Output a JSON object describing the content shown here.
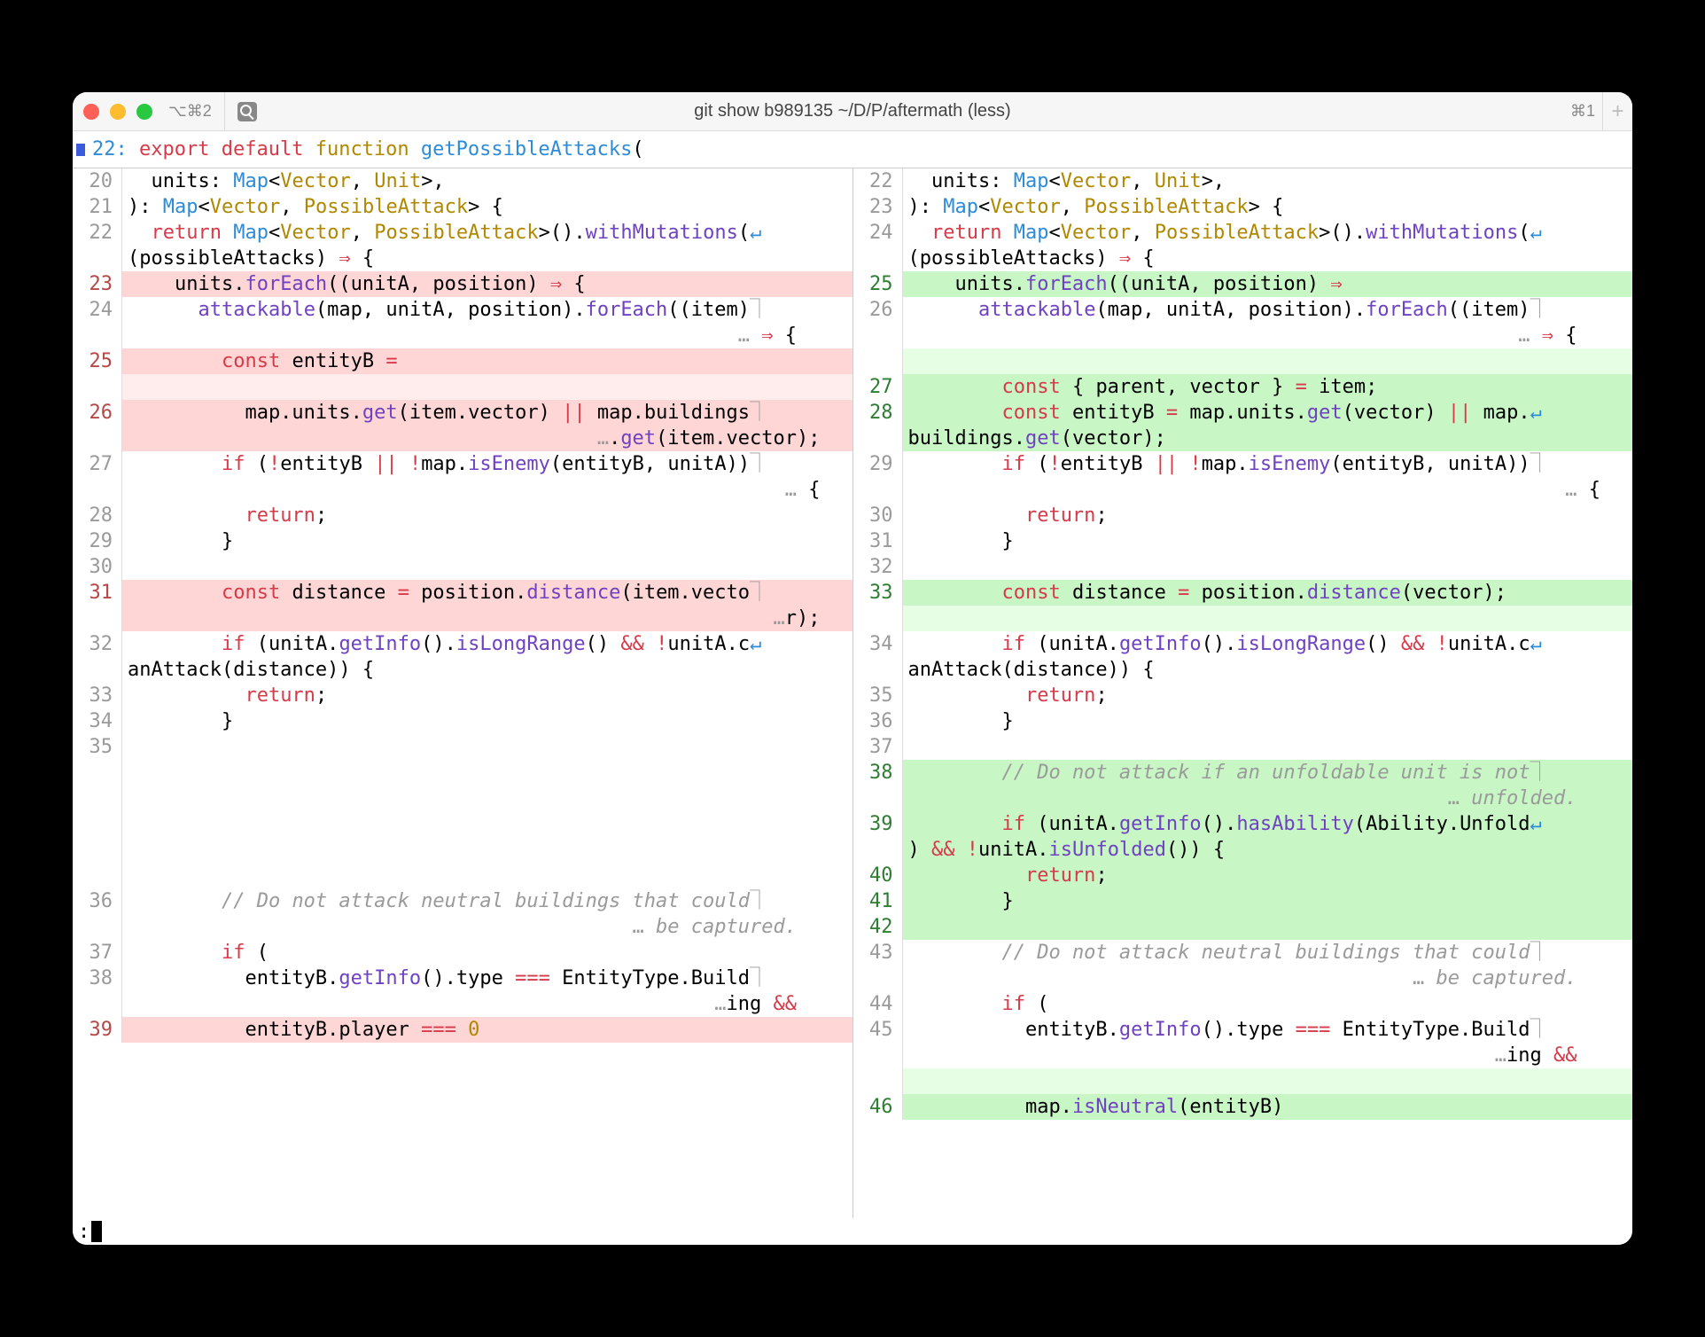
{
  "titlebar": {
    "left_hint": "⌥⌘2",
    "title": "git show b989135 ~/D/P/aftermath (less)",
    "right_hint": "⌘1",
    "plus": "+"
  },
  "headerline": {
    "lineno": "22:",
    "kw_export": "export",
    "kw_default": "default",
    "kw_function": "function",
    "fn_name": "getPossibleAttacks",
    "paren": "("
  },
  "left": [
    {
      "n": "20",
      "cls": "",
      "html": "  units: <span class='c-blue'>Map</span>&lt;<span class='c-type'>Vector</span>, <span class='c-type'>Unit</span>&gt;,"
    },
    {
      "n": "21",
      "cls": "",
      "html": "): <span class='c-blue'>Map</span>&lt;<span class='c-type'>Vector</span>, <span class='c-type'>PossibleAttack</span>&gt; {"
    },
    {
      "n": "22",
      "cls": "",
      "html": "  <span class='c-kw'>return</span> <span class='c-blue'>Map</span>&lt;<span class='c-type'>Vector</span>, <span class='c-type'>PossibleAttack</span>&gt;().<span class='c-purple'>withMutations</span>(<span class='wrap'>↵</span>"
    },
    {
      "n": "",
      "cls": "",
      "html": "(possibleAttacks) <span class='c-kw'>⇒</span> {"
    },
    {
      "n": "23",
      "cls": "bg-del",
      "g": "chg-del",
      "html": "    units.<span class='c-purple'>forEach</span>((unitA, position) <span class='c-kw'>⇒</span> {"
    },
    {
      "n": "24",
      "cls": "",
      "html": "      <span class='c-purple'>attackable</span>(map, unitA, position).<span class='c-purple'>forEach</span>((item)<span class='cont'>⏋</span>"
    },
    {
      "n": "",
      "cls": "",
      "html": "                                                    <span class='cont'>…</span> <span class='c-kw'>⇒</span> {"
    },
    {
      "n": "25",
      "cls": "bg-del",
      "g": "chg-del",
      "html": "        <span class='c-kw'>const</span> entityB <span class='c-eq'>=</span>"
    },
    {
      "n": "",
      "cls": "bg-del-lt",
      "html": " "
    },
    {
      "n": "26",
      "cls": "bg-del",
      "g": "chg-del",
      "html": "          map.units.<span class='c-purple'>get</span>(item.vector) <span class='c-kw'>||</span> map.buildings<span class='cont'>⏋</span>"
    },
    {
      "n": "",
      "cls": "bg-del",
      "html": "                                        <span class='cont'>…</span>.<span class='c-purple'>get</span>(item.vector);"
    },
    {
      "n": "27",
      "cls": "",
      "html": "        <span class='c-kw'>if</span> (<span class='c-kw'>!</span>entityB <span class='c-kw'>||</span> <span class='c-kw'>!</span>map.<span class='c-purple'>isEnemy</span>(entityB, unitA))<span class='cont'>⏋</span>"
    },
    {
      "n": "",
      "cls": "",
      "html": "                                                        <span class='cont'>…</span> {"
    },
    {
      "n": "28",
      "cls": "",
      "html": "          <span class='c-kw'>return</span>;"
    },
    {
      "n": "29",
      "cls": "",
      "html": "        }"
    },
    {
      "n": "30",
      "cls": "",
      "html": " "
    },
    {
      "n": "31",
      "cls": "bg-del",
      "g": "chg-del",
      "html": "        <span class='c-kw'>const</span> distance <span class='c-eq'>=</span> position.<span class='c-purple'>distance</span>(item.vecto<span class='cont'>⏋</span>"
    },
    {
      "n": "",
      "cls": "bg-del",
      "html": "                                                       <span class='cont'>…</span>r);"
    },
    {
      "n": "32",
      "cls": "",
      "html": "        <span class='c-kw'>if</span> (unitA.<span class='c-purple'>getInfo</span>().<span class='c-purple'>isLongRange</span>() <span class='c-kw'>&amp;&amp;</span> <span class='c-kw'>!</span>unitA.c<span class='wrap'>↵</span>"
    },
    {
      "n": "",
      "cls": "",
      "html": "anAttack(distance)) {"
    },
    {
      "n": "33",
      "cls": "",
      "html": "          <span class='c-kw'>return</span>;"
    },
    {
      "n": "34",
      "cls": "",
      "html": "        }"
    },
    {
      "n": "35",
      "cls": "",
      "html": " "
    },
    {
      "n": "",
      "cls": "",
      "html": " "
    },
    {
      "n": "",
      "cls": "",
      "html": " "
    },
    {
      "n": "",
      "cls": "",
      "html": " "
    },
    {
      "n": "",
      "cls": "",
      "html": " "
    },
    {
      "n": "",
      "cls": "",
      "html": " "
    },
    {
      "n": "36",
      "cls": "",
      "html": "        <span class='c-comment'>// Do not attack neutral buildings that could</span><span class='cont'>⏋</span>"
    },
    {
      "n": "",
      "cls": "",
      "html": "                                           <span class='cont'>…</span><span class='c-comment'> be captured.</span>"
    },
    {
      "n": "37",
      "cls": "",
      "html": "        <span class='c-kw'>if</span> ("
    },
    {
      "n": "38",
      "cls": "",
      "html": "          entityB.<span class='c-purple'>getInfo</span>().type <span class='c-kw'>===</span> EntityType.Build<span class='cont'>⏋</span>"
    },
    {
      "n": "",
      "cls": "",
      "html": "                                                  <span class='cont'>…</span>ing <span class='c-kw'>&amp;&amp;</span>"
    },
    {
      "n": "39",
      "cls": "bg-del",
      "g": "chg-del",
      "html": "          entityB.player <span class='c-kw'>===</span> <span class='c-num'>0</span>"
    }
  ],
  "right": [
    {
      "n": "22",
      "cls": "",
      "html": "  units: <span class='c-blue'>Map</span>&lt;<span class='c-type'>Vector</span>, <span class='c-type'>Unit</span>&gt;,"
    },
    {
      "n": "23",
      "cls": "",
      "html": "): <span class='c-blue'>Map</span>&lt;<span class='c-type'>Vector</span>, <span class='c-type'>PossibleAttack</span>&gt; {"
    },
    {
      "n": "24",
      "cls": "",
      "html": "  <span class='c-kw'>return</span> <span class='c-blue'>Map</span>&lt;<span class='c-type'>Vector</span>, <span class='c-type'>PossibleAttack</span>&gt;().<span class='c-purple'>withMutations</span>(<span class='wrap'>↵</span>"
    },
    {
      "n": "",
      "cls": "",
      "html": "(possibleAttacks) <span class='c-kw'>⇒</span> {"
    },
    {
      "n": "25",
      "cls": "bg-add",
      "g": "chg-add",
      "html": "    units.<span class='c-purple'>forEach</span>((unitA, position) <span class='c-kw'>⇒</span>"
    },
    {
      "n": "26",
      "cls": "",
      "html": "      <span class='c-purple'>attackable</span>(map, unitA, position).<span class='c-purple'>forEach</span>((item)<span class='cont'>⏋</span>"
    },
    {
      "n": "",
      "cls": "",
      "html": "                                                    <span class='cont'>…</span> <span class='c-kw'>⇒</span> {"
    },
    {
      "n": "",
      "cls": "bg-add-lt",
      "html": " "
    },
    {
      "n": "27",
      "cls": "bg-add",
      "g": "chg-add",
      "html": "        <span class='c-kw'>const</span> { parent, vector } <span class='c-eq'>=</span> item;"
    },
    {
      "n": "28",
      "cls": "bg-add",
      "g": "chg-add",
      "html": "<span class='sel'> </span>       <span class='sel'><span class='c-kw'>const</span> entityB <span class='c-eq'>=</span></span> map.units.<span class='c-purple'>get</span>(vector) <span class='c-kw'>||</span> map.<span class='wrap'>↵</span>"
    },
    {
      "n": "",
      "cls": "bg-add",
      "html": "buildings.<span class='c-purple'>get</span>(vector);"
    },
    {
      "n": "29",
      "cls": "",
      "html": "        <span class='c-kw'>if</span> (<span class='c-kw'>!</span>entityB <span class='c-kw'>||</span> <span class='c-kw'>!</span>map.<span class='c-purple'>isEnemy</span>(entityB, unitA))<span class='cont'>⏋</span>"
    },
    {
      "n": "",
      "cls": "",
      "html": "                                                        <span class='cont'>…</span> {"
    },
    {
      "n": "30",
      "cls": "",
      "html": "          <span class='c-kw'>return</span>;"
    },
    {
      "n": "31",
      "cls": "",
      "html": "        }"
    },
    {
      "n": "32",
      "cls": "",
      "html": " "
    },
    {
      "n": "33",
      "cls": "bg-add",
      "g": "chg-add",
      "html": "        <span class='c-kw'>const</span> distance <span class='c-eq'>=</span> position.<span class='c-purple'>distance</span>(vector);"
    },
    {
      "n": "",
      "cls": "bg-add-lt",
      "html": " "
    },
    {
      "n": "34",
      "cls": "",
      "html": "        <span class='c-kw'>if</span> (unitA.<span class='c-purple'>getInfo</span>().<span class='c-purple'>isLongRange</span>() <span class='c-kw'>&amp;&amp;</span> <span class='c-kw'>!</span>unitA.c<span class='wrap'>↵</span>"
    },
    {
      "n": "",
      "cls": "",
      "html": "anAttack(distance)) {"
    },
    {
      "n": "35",
      "cls": "",
      "html": "          <span class='c-kw'>return</span>;"
    },
    {
      "n": "36",
      "cls": "",
      "html": "        }"
    },
    {
      "n": "37",
      "cls": "",
      "html": " "
    },
    {
      "n": "38",
      "cls": "bg-add",
      "g": "chg-add",
      "html": "        <span class='c-comment'>// Do not attack if an unfoldable unit is not</span><span class='cont'>⏋</span>"
    },
    {
      "n": "",
      "cls": "bg-add",
      "html": "                                              <span class='cont'>…</span><span class='c-comment'> unfolded.</span>"
    },
    {
      "n": "39",
      "cls": "bg-add",
      "g": "chg-add",
      "html": "        <span class='c-kw'>if</span> (unitA.<span class='c-purple'>getInfo</span>().<span class='c-purple'>hasAbility</span>(Ability.Unfold<span class='wrap'>↵</span>"
    },
    {
      "n": "",
      "cls": "bg-add",
      "html": ") <span class='c-kw'>&amp;&amp;</span> <span class='c-kw'>!</span>unitA.<span class='c-purple'>isUnfolded</span>()) {"
    },
    {
      "n": "40",
      "cls": "bg-add",
      "g": "chg-add",
      "html": "          <span class='c-kw'>return</span>;"
    },
    {
      "n": "41",
      "cls": "bg-add",
      "g": "chg-add",
      "html": "        }"
    },
    {
      "n": "42",
      "cls": "bg-add",
      "g": "chg-add",
      "html": " "
    },
    {
      "n": "43",
      "cls": "",
      "html": "        <span class='c-comment'>// Do not attack neutral buildings that could</span><span class='cont'>⏋</span>"
    },
    {
      "n": "",
      "cls": "",
      "html": "                                           <span class='cont'>…</span><span class='c-comment'> be captured.</span>"
    },
    {
      "n": "44",
      "cls": "",
      "html": "        <span class='c-kw'>if</span> ("
    },
    {
      "n": "45",
      "cls": "",
      "html": "          entityB.<span class='c-purple'>getInfo</span>().type <span class='c-kw'>===</span> EntityType.Build<span class='cont'>⏋</span>"
    },
    {
      "n": "",
      "cls": "",
      "html": "                                                  <span class='cont'>…</span>ing <span class='c-kw'>&amp;&amp;</span>"
    },
    {
      "n": "",
      "cls": "bg-add-lt",
      "html": " "
    },
    {
      "n": "46",
      "cls": "bg-add",
      "g": "chg-add",
      "html": "          map.<span class='c-purple'>isNeutral</span>(entityB)"
    }
  ],
  "prompt": ":"
}
